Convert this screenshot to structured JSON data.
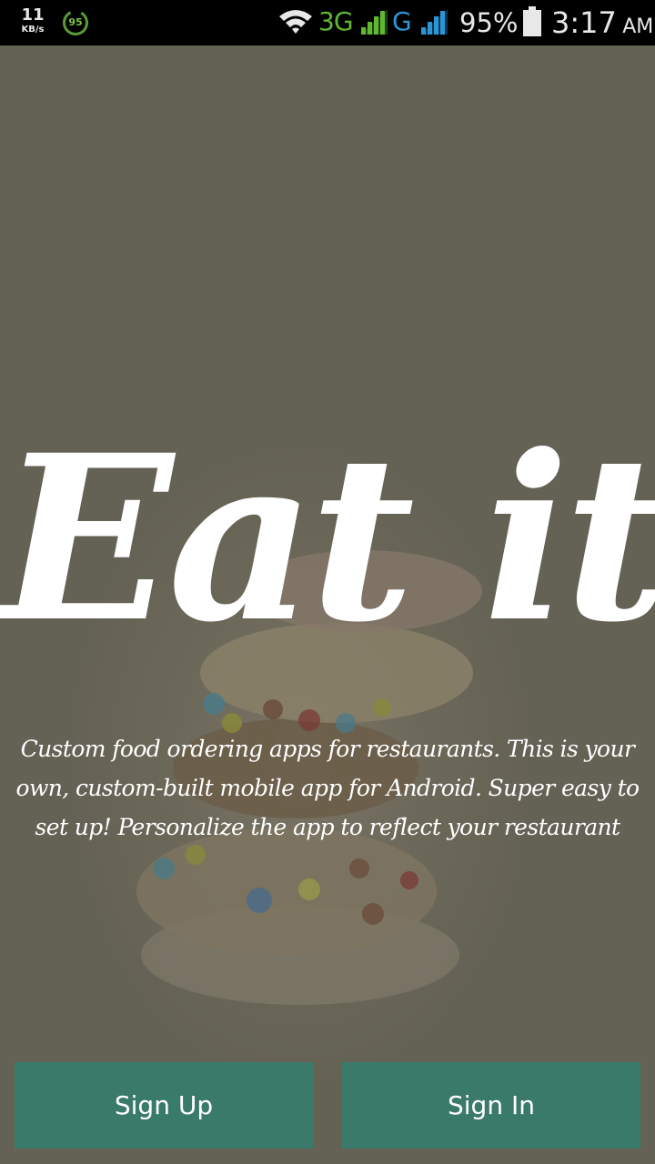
{
  "status_bar": {
    "net_speed_value": "11",
    "net_speed_unit": "KB/s",
    "ring_badge": "95",
    "network_3g": "3G",
    "network_g": "G",
    "battery_percent": "95%",
    "time": "3:17",
    "ampm": "AM",
    "icons": [
      "wifi-icon",
      "signal-icon",
      "battery-icon"
    ]
  },
  "main": {
    "logo_text": "Eat it",
    "tagline": "Custom food ordering apps for restaurants. This is your own, custom-built mobile app for Android. Super easy to set up! Personalize the app to reflect your restaurant"
  },
  "buttons": {
    "sign_up": "Sign Up",
    "sign_in": "Sign In"
  },
  "colors": {
    "button_bg": "#3a7a6a",
    "overlay_bg": "#6c6859",
    "status_bar_bg": "#000000",
    "network_3g": "#5fb830",
    "network_g": "#2a96d8"
  }
}
